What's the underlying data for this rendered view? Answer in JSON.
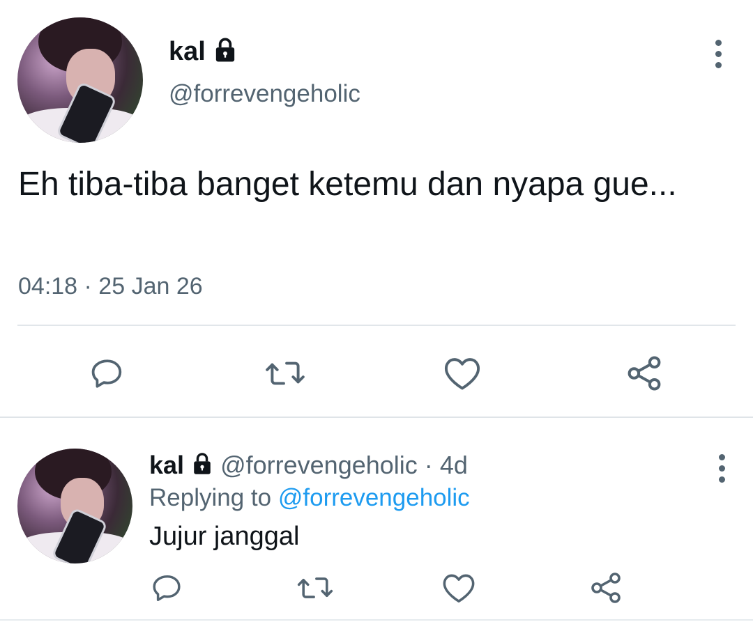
{
  "tweet": {
    "display_name": "kal",
    "handle": "@forrevengeholic",
    "text": "Eh tiba-tiba banget ketemu dan nyapa gue...",
    "timestamp": "04:18 · 25 Jan 26",
    "icons": [
      "lock-icon",
      "more-vertical-icon",
      "reply-icon",
      "retweet-icon",
      "like-icon",
      "share-icon"
    ]
  },
  "reply": {
    "display_name": "kal",
    "handle": "@forrevengeholic",
    "separator": "·",
    "age": "4d",
    "replying_prefix": "Replying to",
    "replying_handle": "@forrevengeholic",
    "text": "Jujur janggal"
  },
  "colors": {
    "text": "#0f1419",
    "secondary": "#536471",
    "link": "#1d9bf0",
    "divider": "#e1e6ea"
  }
}
